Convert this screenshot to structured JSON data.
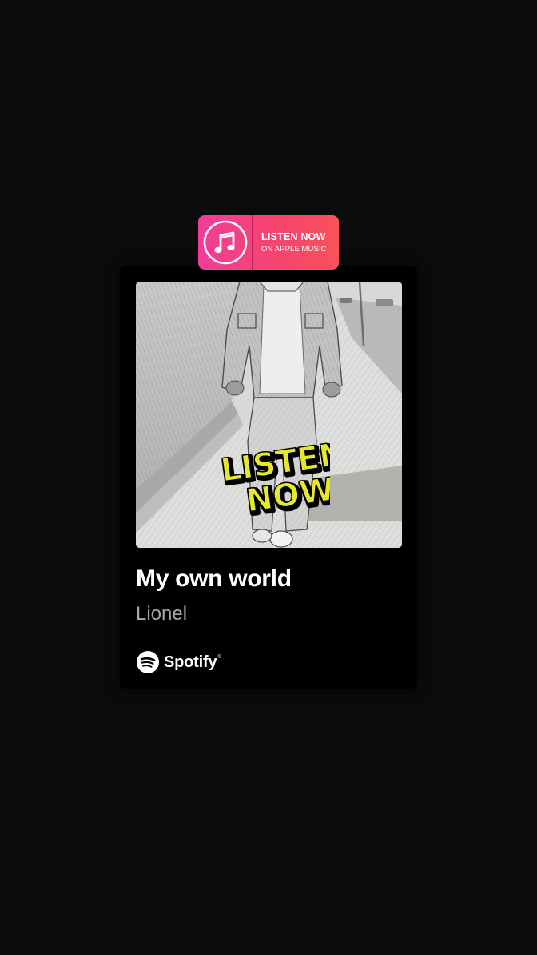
{
  "apple_badge": {
    "title": "LISTEN NOW",
    "subtitle": "ON APPLE MUSIC",
    "icon": "music-note-icon",
    "colors": {
      "start": "#f23c9a",
      "end": "#f8525a"
    }
  },
  "card": {
    "cover_sticker": {
      "line1": "LISTEN",
      "line2": "NOW",
      "color": "#e6e82a"
    },
    "song_title": "My own world",
    "artist": "Lionel",
    "platform": {
      "name": "Spotify",
      "icon": "spotify-icon",
      "trademark": "®"
    }
  }
}
